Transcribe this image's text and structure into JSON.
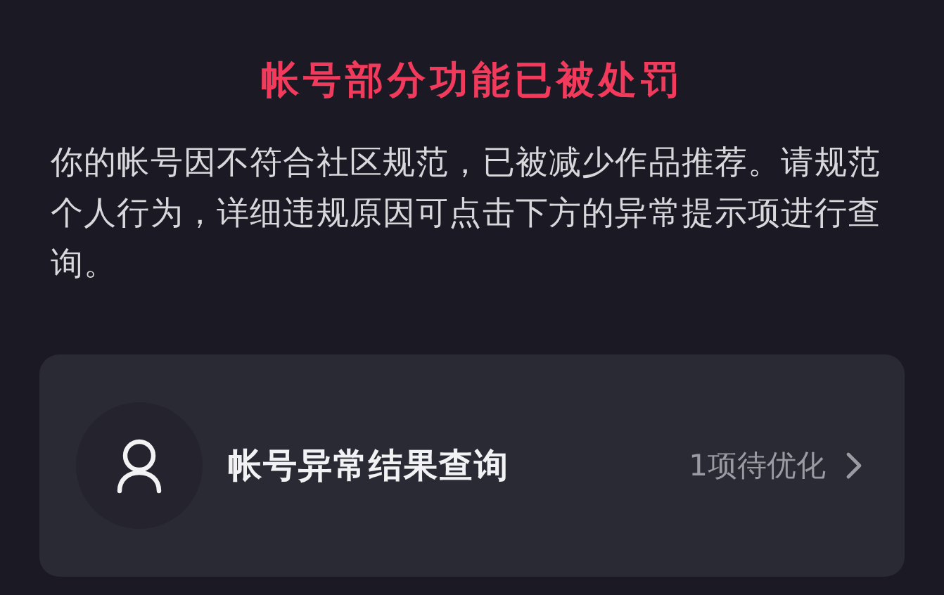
{
  "title": "帐号部分功能已被处罚",
  "message": "你的帐号因不符合社区规范，已被减少作品推荐。请规范个人行为，详细违规原因可点击下方的异常提示项进行查询。",
  "result_item": {
    "label": "帐号异常结果查询",
    "status": "1项待优化"
  }
}
